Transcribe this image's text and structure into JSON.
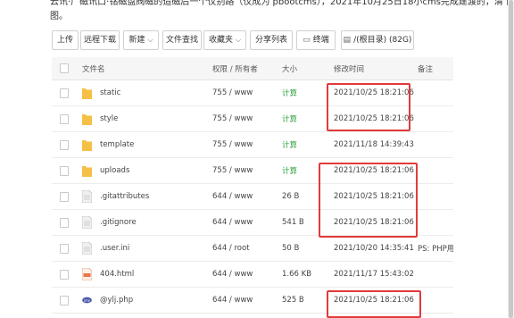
{
  "intro_text": "云讯·广磁讯口·铭磁盘阀磁的造磁后一个仪别路（仪成为 pbootcms），2021年10月25日18小cms完成建渡的，清下图。",
  "toolbar": {
    "upload": "上传",
    "remote_download": "远程下载",
    "new": "新建",
    "file_search": "文件查找",
    "favorites": "收藏夹",
    "share_list": "分享列表",
    "terminal": "终端",
    "path": "/(根目录) (82G)"
  },
  "columns": {
    "name": "文件名",
    "perm": "权限 / 所有者",
    "size": "大小",
    "mtime": "修改时间",
    "note": "备注"
  },
  "files": [
    {
      "name": "static",
      "type": "folder",
      "perm": "755 / www",
      "size": "计算",
      "mtime": "2021/10/25 18:21:06",
      "note": ""
    },
    {
      "name": "style",
      "type": "folder",
      "perm": "755 / www",
      "size": "计算",
      "mtime": "2021/10/25 18:21:06",
      "note": ""
    },
    {
      "name": "template",
      "type": "folder",
      "perm": "755 / www",
      "size": "计算",
      "mtime": "2021/11/18 14:39:43",
      "note": ""
    },
    {
      "name": "uploads",
      "type": "folder",
      "perm": "755 / www",
      "size": "计算",
      "mtime": "2021/10/25 18:21:06",
      "note": ""
    },
    {
      "name": ".gitattributes",
      "type": "file",
      "perm": "644 / www",
      "size": "26 B",
      "mtime": "2021/10/25 18:21:06",
      "note": ""
    },
    {
      "name": ".gitignore",
      "type": "file",
      "perm": "644 / www",
      "size": "541 B",
      "mtime": "2021/10/25 18:21:06",
      "note": ""
    },
    {
      "name": ".user.ini",
      "type": "file",
      "perm": "644 / root",
      "size": "50 B",
      "mtime": "2021/10/20 14:35:41",
      "note": "PS: PHP用"
    },
    {
      "name": "404.html",
      "type": "html",
      "perm": "644 / www",
      "size": "1.66 KB",
      "mtime": "2021/11/17 15:43:02",
      "note": ""
    },
    {
      "name": "@ylj.php",
      "type": "php",
      "perm": "644 / www",
      "size": "525 B",
      "mtime": "2021/10/25 18:21:06",
      "note": ""
    }
  ],
  "colors": {
    "highlight": "#e23a3a",
    "folder": "#f5c046",
    "calc": "#2e9e3a"
  }
}
